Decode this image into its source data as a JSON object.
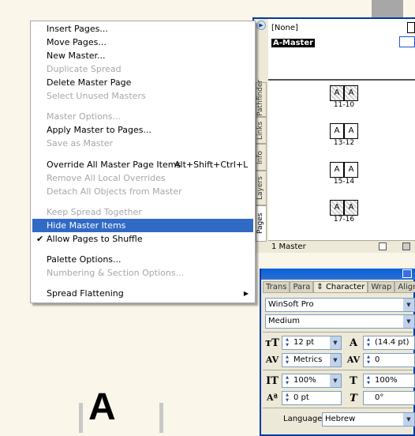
{
  "menu": {
    "items": [
      {
        "label": "Insert Pages...",
        "enabled": true
      },
      {
        "label": "Move Pages...",
        "enabled": true
      },
      {
        "label": "New Master...",
        "enabled": true
      },
      {
        "label": "Duplicate Spread",
        "enabled": false
      },
      {
        "label": "Delete Master Page",
        "enabled": true
      },
      {
        "label": "Select Unused Masters",
        "enabled": false
      },
      {
        "label": "Master Options...",
        "enabled": false
      },
      {
        "label": "Apply Master to Pages...",
        "enabled": true
      },
      {
        "label": "Save as Master",
        "enabled": false
      },
      {
        "label": "Override All Master Page Items",
        "shortcut": "Alt+Shift+Ctrl+L",
        "enabled": true
      },
      {
        "label": "Remove All Local Overrides",
        "enabled": false
      },
      {
        "label": "Detach All Objects from Master",
        "enabled": false
      },
      {
        "label": "Keep Spread Together",
        "enabled": false
      },
      {
        "label": "Hide Master Items",
        "enabled": true,
        "highlighted": true
      },
      {
        "label": "Allow Pages to Shuffle",
        "enabled": true,
        "checked": true
      },
      {
        "label": "Palette Options...",
        "enabled": true
      },
      {
        "label": "Numbering & Section Options...",
        "enabled": false
      },
      {
        "label": "Spread Flattening",
        "enabled": true,
        "submenu": true
      }
    ],
    "checkmark": "✔",
    "submenu_arrow": "▶"
  },
  "pages_panel": {
    "masters": [
      {
        "label": "[None]"
      },
      {
        "label": "A-Master",
        "selected": true
      }
    ],
    "page_letter": "A",
    "spreads": [
      {
        "label": "11-10"
      },
      {
        "label": "13-12"
      },
      {
        "label": "15-14"
      },
      {
        "label": "17-16"
      }
    ],
    "tabs": [
      "Pages",
      "Layers",
      "Info",
      "Links",
      "Pathfinder"
    ],
    "status": "1 Master"
  },
  "character_panel": {
    "tabs": [
      "Trans",
      "Para",
      "Character",
      "Wrap",
      "Align"
    ],
    "font_family": "WinSoft Pro",
    "font_style": "Medium",
    "font_size": "12 pt",
    "leading": "(14.4 pt)",
    "kerning": "Metrics",
    "tracking": "0",
    "vertical_scale": "100%",
    "horizontal_scale": "100%",
    "baseline_shift": "0 pt",
    "skew": "0°",
    "language_label": "Language:",
    "language": "Hebrew"
  },
  "canvas": {
    "glyph": "A"
  },
  "colors": {
    "highlight": "#316ac5",
    "panel_border": "#003c9e",
    "panel_bg": "#ece9d8"
  }
}
